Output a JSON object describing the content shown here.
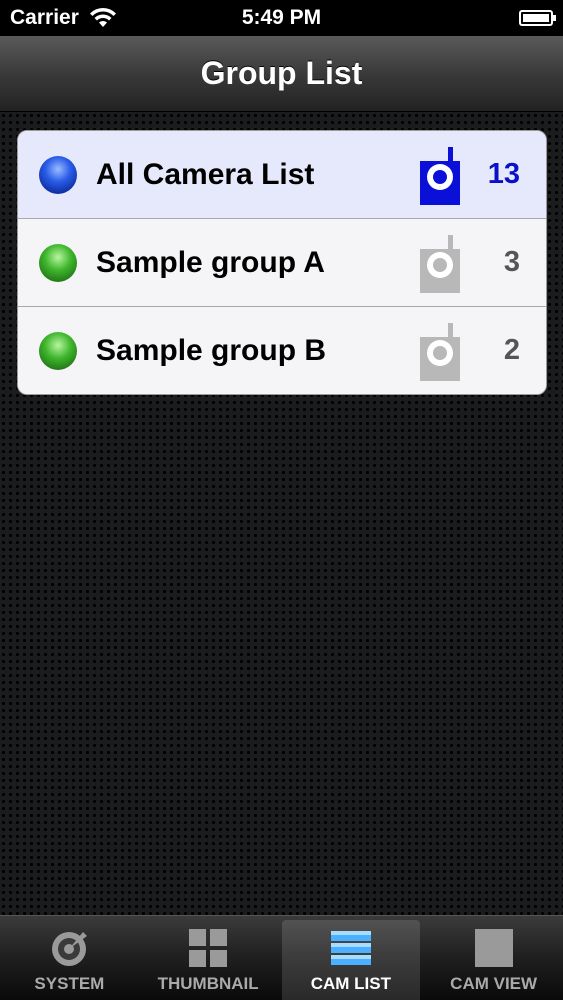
{
  "status_bar": {
    "carrier": "Carrier",
    "time": "5:49 PM",
    "wifi_icon": "wifi-icon",
    "battery_icon": "battery-icon"
  },
  "nav": {
    "title": "Group List"
  },
  "groups": [
    {
      "label": "All Camera List",
      "count": "13",
      "status_color": "#2a5ce8",
      "icon": "camera-icon",
      "selected": true
    },
    {
      "label": "Sample group A",
      "count": "3",
      "status_color": "#3fb62c",
      "icon": "camera-icon",
      "selected": false
    },
    {
      "label": "Sample group B",
      "count": "2",
      "status_color": "#3fb62c",
      "icon": "camera-icon",
      "selected": false
    }
  ],
  "tabs": [
    {
      "label": "SYSTEM",
      "icon": "system-icon",
      "active": false
    },
    {
      "label": "THUMBNAIL",
      "icon": "thumbnail-grid-icon",
      "active": false
    },
    {
      "label": "CAM LIST",
      "icon": "cam-list-icon",
      "active": true
    },
    {
      "label": "CAM VIEW",
      "icon": "cam-view-icon",
      "active": false
    }
  ],
  "colors": {
    "selected_row": "#e6e9fb",
    "selected_count": "#0a10c8",
    "camera_active": "#0a10d8",
    "camera_inactive": "#b8b8b8"
  }
}
